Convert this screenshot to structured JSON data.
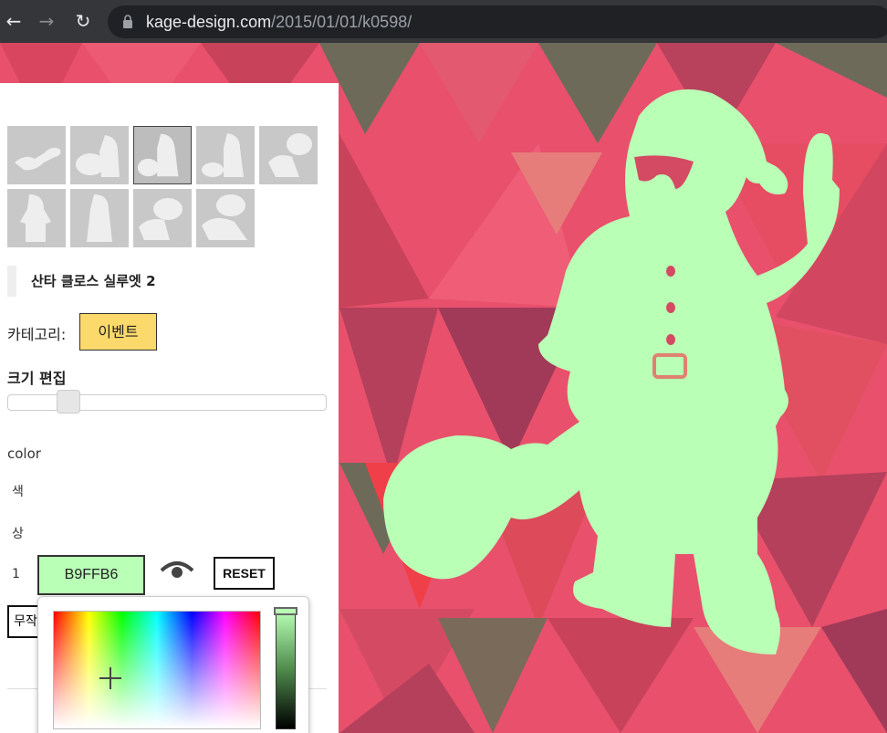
{
  "browser": {
    "url_domain": "kage-design.com",
    "url_path": "/2015/01/01/k0598/"
  },
  "item": {
    "title": "산타 클로스 실루엣 2",
    "category_label": "카테고리:",
    "category_value": "이벤트"
  },
  "size_section": {
    "title": "크기 편집",
    "slider_value_fraction": 0.19
  },
  "color_section": {
    "title": "color",
    "label_1": "색",
    "label_2": "상",
    "label_3": "1",
    "hex_value": "B9FFB6",
    "reset_label": "RESET",
    "random_label": "무작위"
  },
  "colors": {
    "silhouette": "#b9ffb6",
    "category_badge": "#fbd96b",
    "background_main": "#e8506c"
  },
  "icons": [
    "back-icon",
    "forward-icon",
    "reload-icon",
    "lock-icon",
    "eye-icon",
    "crosshair-icon"
  ]
}
